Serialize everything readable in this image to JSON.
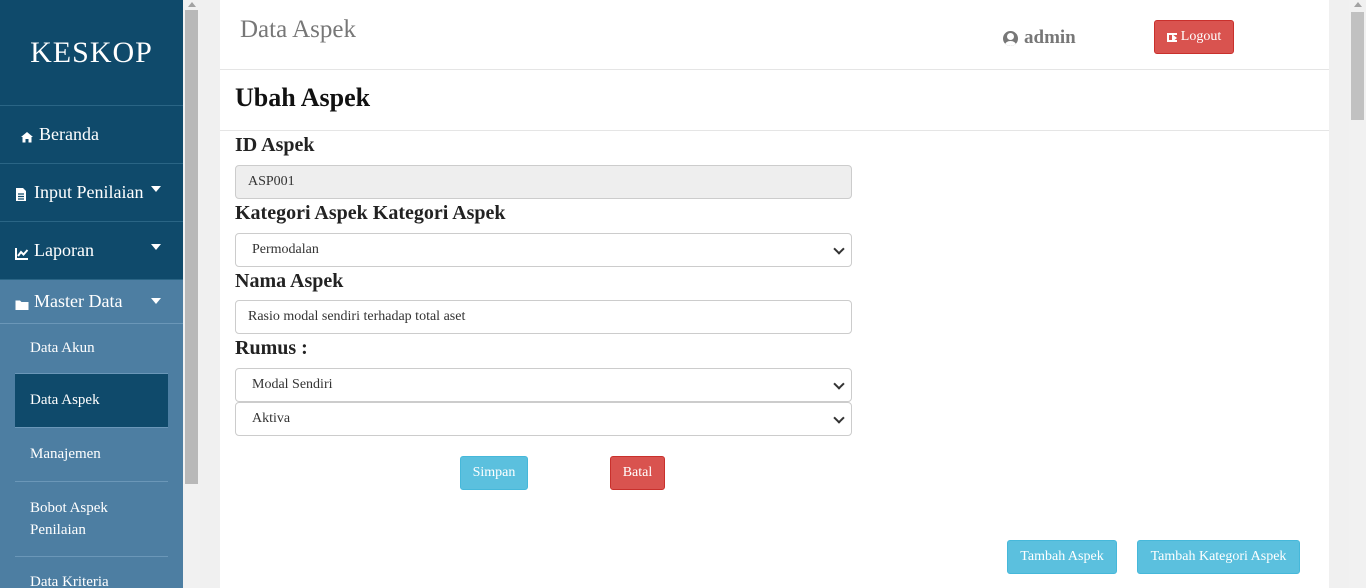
{
  "sidebar": {
    "brand": "KESKOP",
    "items": [
      {
        "label": "Beranda"
      },
      {
        "label": "Input Penilaian"
      },
      {
        "label": "Laporan"
      }
    ],
    "master": {
      "label": "Master Data",
      "subitems": [
        {
          "label": "Data Akun"
        },
        {
          "label": "Data Aspek"
        },
        {
          "label": "Manajemen"
        },
        {
          "label": "Bobot Aspek Penilaian"
        },
        {
          "label": "Data Kriteria"
        }
      ]
    }
  },
  "header": {
    "title": "Data Aspek",
    "user": "admin",
    "logout_label": "Logout"
  },
  "form": {
    "heading": "Ubah Aspek",
    "id_label": "ID Aspek",
    "id_value": "ASP001",
    "kategori_label": "Kategori Aspek Kategori Aspek",
    "kategori_value": "Permodalan",
    "nama_label": "Nama Aspek",
    "nama_value": "Rasio modal sendiri terhadap total aset",
    "rumus_label": "Rumus :",
    "rumus_1": "Modal Sendiri",
    "rumus_2": "Aktiva",
    "save_label": "Simpan",
    "cancel_label": "Batal"
  },
  "actions": {
    "add_aspek": "Tambah Aspek",
    "add_kategori": "Tambah Kategori Aspek"
  },
  "colors": {
    "sidebar": "#0f4a6b",
    "submenu": "#4d7ea2",
    "danger": "#d9534f",
    "info": "#5bc0de"
  }
}
